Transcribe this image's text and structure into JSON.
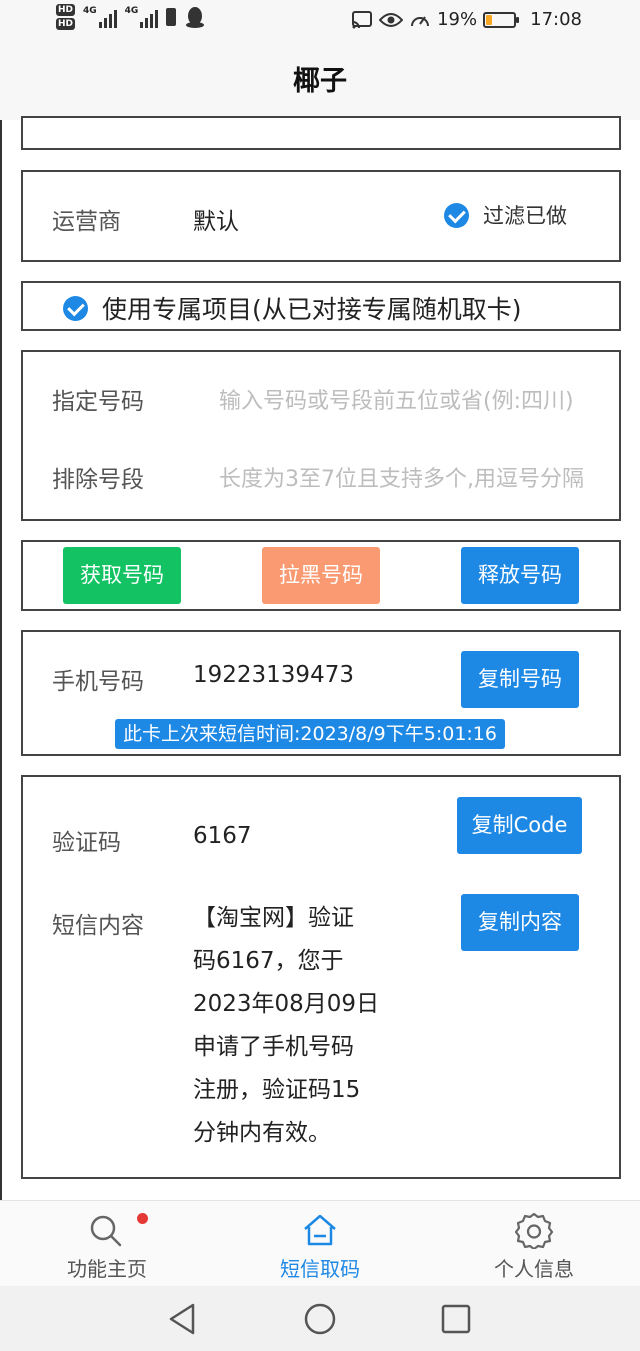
{
  "status": {
    "battery_percent": "19%",
    "battery_level": 0.19,
    "time": "17:08",
    "hd1": "HD",
    "hd2": "HD",
    "net1": "4G",
    "net2": "4G",
    "icons": [
      "hd-icon",
      "signal-icon",
      "battery-saver-icon",
      "qq-icon",
      "cast-icon",
      "eye-icon",
      "speed-icon",
      "battery-icon"
    ]
  },
  "header": {
    "title": "椰子"
  },
  "operator": {
    "label": "运营商",
    "value": "默认",
    "filter_label": "过滤已做"
  },
  "exclusive": {
    "label": "使用专属项目(从已对接专属随机取卡)"
  },
  "fields": {
    "specify_label": "指定号码",
    "specify_placeholder": "输入号码或号段前五位或省(例:四川)",
    "exclude_label": "排除号段",
    "exclude_placeholder": "长度为3至7位且支持多个,用逗号分隔"
  },
  "actions": {
    "get_number": "获取号码",
    "blacklist_number": "拉黑号码",
    "release_number": "释放号码"
  },
  "phone": {
    "label": "手机号码",
    "value": "19223139473",
    "copy_label": "复制号码",
    "last_sms_notice": "此卡上次来短信时间:2023/8/9下午5:01:16"
  },
  "code": {
    "label": "验证码",
    "value": "6167",
    "copy_label": "复制Code",
    "sms_label": "短信内容",
    "sms_lines": [
      "【淘宝网】验证",
      "码6167，您于",
      "2023年08月09日",
      "申请了手机号码",
      "注册，验证码15",
      "分钟内有效。"
    ],
    "copy_sms_label": "复制内容"
  },
  "tabs": [
    {
      "label": "功能主页",
      "icon": "search-icon",
      "active": false
    },
    {
      "label": "短信取码",
      "icon": "home-icon",
      "active": true
    },
    {
      "label": "个人信息",
      "icon": "gear-icon",
      "active": false
    }
  ],
  "colors": {
    "accent": "#1e88e5",
    "green": "#12c263",
    "orange": "#f99a72",
    "badge": "#e53935"
  }
}
